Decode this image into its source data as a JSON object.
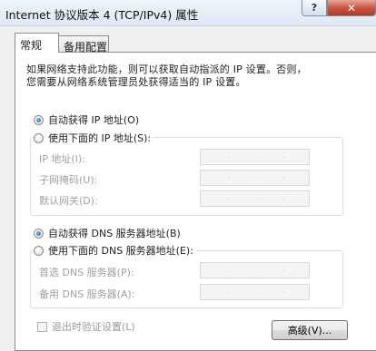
{
  "window": {
    "title": "Internet 协议版本 4 (TCP/IPv4) 属性",
    "help_glyph": "?",
    "close_glyph": "✕"
  },
  "tabs": [
    {
      "label": "常规",
      "selected": true
    },
    {
      "label": "备用配置",
      "selected": false
    }
  ],
  "general": {
    "intro_lines": [
      "如果网络支持此功能，则可以获取自动指派的 IP 设置。否则，",
      "您需要从网络系统管理员处获得适当的 IP 设置。"
    ],
    "ip_auto_label": "自动获得 IP 地址(O)",
    "ip_auto_selected": true,
    "ip_manual_label": "使用下面的 IP 地址(S):",
    "ip_fields": [
      {
        "label": "IP 地址(I):",
        "value": ". . ."
      },
      {
        "label": "子网掩码(U):",
        "value": ". . ."
      },
      {
        "label": "默认网关(D):",
        "value": ". . ."
      }
    ],
    "dns_auto_label": "自动获得 DNS 服务器地址(B)",
    "dns_auto_selected": true,
    "dns_manual_label": "使用下面的 DNS 服务器地址(E):",
    "dns_fields": [
      {
        "label": "首选 DNS 服务器(P):",
        "value": ". . ."
      },
      {
        "label": "备用 DNS 服务器(A):",
        "value": ". . ."
      }
    ],
    "validate_on_exit_label": "退出时验证设置(L)",
    "validate_on_exit_checked": false,
    "advanced_button_label": "高级(V)..."
  }
}
